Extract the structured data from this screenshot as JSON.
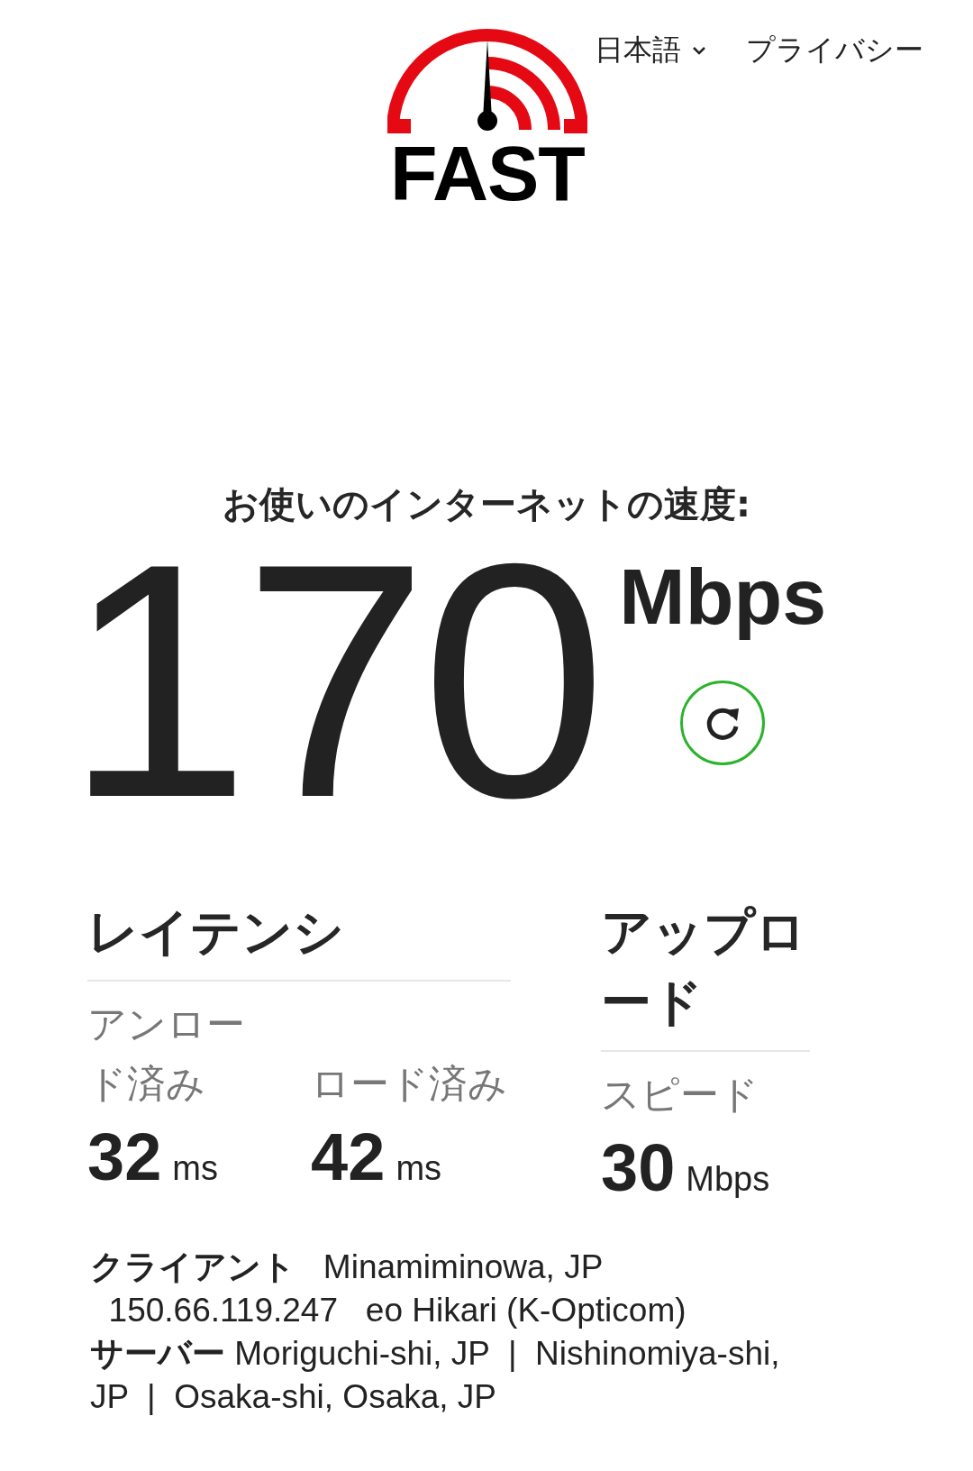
{
  "header": {
    "logo": "FAST",
    "language": "日本語",
    "privacy": "プライバシー"
  },
  "speed": {
    "title": "お使いのインターネットの速度:",
    "value": "170",
    "unit": "Mbps"
  },
  "latency": {
    "title": "レイテンシ",
    "items": [
      {
        "label": "アンロード済み",
        "value": "32",
        "unit": "ms"
      },
      {
        "label": "ロード済み",
        "value": "42",
        "unit": "ms"
      }
    ]
  },
  "upload": {
    "title": "アップロード",
    "items": [
      {
        "label": "スピード",
        "value": "30",
        "unit": "Mbps"
      }
    ]
  },
  "client": {
    "lines": [
      "**クライアント**   Minamiminowa, JP",
      "  150.66.119.247   eo Hikari (K-Opticom)"
    ]
  },
  "server": {
    "text": "**サーバー** Moriguchi-shi, JP  |  Nishinomiya-shi, JP  |  Osaka-shi, Osaka, JP"
  }
}
